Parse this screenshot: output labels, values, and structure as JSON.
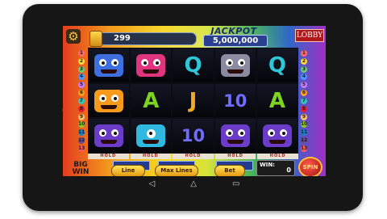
{
  "game": {
    "credits": "299",
    "jackpot_label": "JACKPOT",
    "jackpot_value": "5,000,000",
    "lobby_label": "LOBBY",
    "big_win_line1": "BIG",
    "big_win_line2": "WIN",
    "hold_label": "HOLD",
    "buttons": {
      "line": "Line",
      "max_lines": "Max Lines",
      "bet": "Bet",
      "spin": "SPIN"
    },
    "win_label": "WIN:",
    "win_value": "0"
  },
  "paylines_left": [
    "1",
    "2",
    "3",
    "4",
    "5",
    "6",
    "7",
    "8",
    "9",
    "10",
    "11",
    "12",
    "13"
  ],
  "paylines_right": [
    "1",
    "2",
    "3",
    "4",
    "5",
    "6",
    "7",
    "8",
    "9",
    "10",
    "11",
    "12",
    "13"
  ],
  "reels": [
    [
      "blue-monster",
      "ninja-monster",
      "purple-monster"
    ],
    [
      "pink-monster",
      "A",
      "cyclops-monster"
    ],
    [
      "Q",
      "J",
      "10"
    ],
    [
      "shark-monster",
      "10",
      "purple-monster"
    ],
    [
      "Q",
      "A",
      "purple-monster"
    ]
  ],
  "colors": {
    "letter_A": "#7ed321",
    "letter_Q": "#2fc6d6",
    "letter_J": "#f5a623",
    "number_10": "#6f6cff",
    "payline_palette": [
      "#ff6b6b",
      "#ffd93d",
      "#6bcB77",
      "#4d96ff",
      "#c77dff",
      "#ff9f1c",
      "#2ec4b6",
      "#e71d36",
      "#ffbf69",
      "#8ac926",
      "#1982c4",
      "#6a4c93",
      "#ff595e"
    ]
  }
}
